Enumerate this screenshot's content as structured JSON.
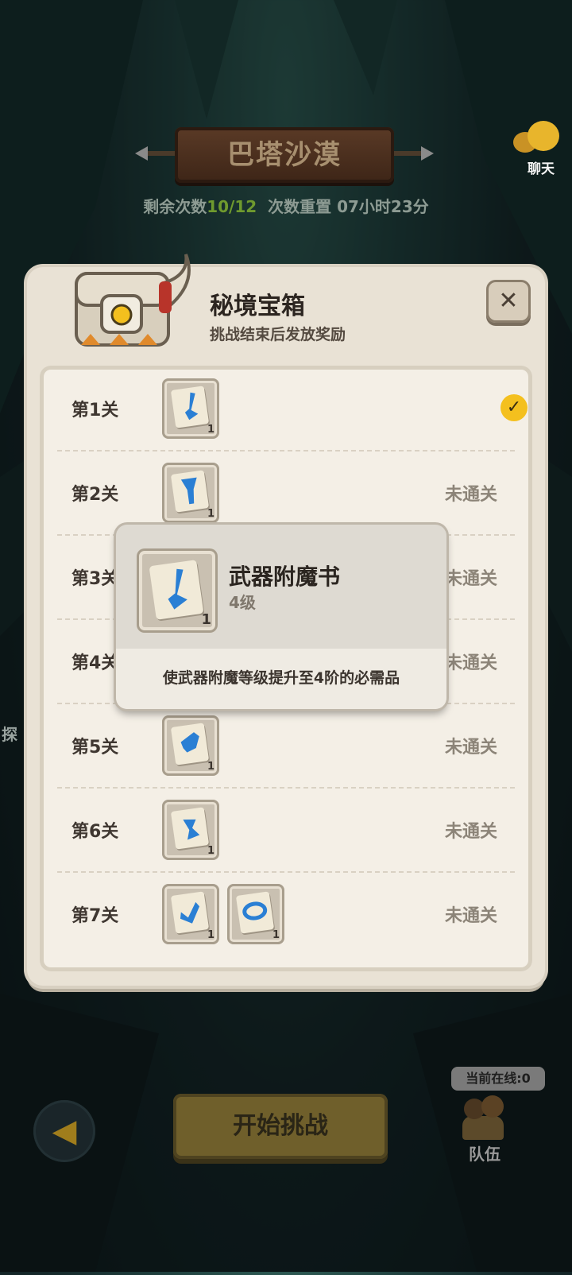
{
  "header": {
    "stage_name": "巴塔沙漠",
    "attempts_prefix": "剩余次数",
    "attempts_value": "10/12",
    "reset_text": "次数重置 07小时23分"
  },
  "chat": {
    "label": "聊天",
    "icon": "chat-bubble-icon"
  },
  "panel": {
    "title": "秘境宝箱",
    "subtitle": "挑战结束后发放奖励",
    "close_symbol": "✕"
  },
  "levels": [
    {
      "label": "第1关",
      "status": "",
      "cleared": true,
      "items": [
        {
          "icon": "enchant-scroll-icon",
          "qty": "1"
        }
      ]
    },
    {
      "label": "第2关",
      "status": "未通关",
      "cleared": false,
      "items": [
        {
          "icon": "enchant-scroll-icon",
          "qty": "1"
        }
      ]
    },
    {
      "label": "第3关",
      "status": "未通关",
      "cleared": false,
      "items": []
    },
    {
      "label": "第4关",
      "status": "未通关",
      "cleared": false,
      "items": []
    },
    {
      "label": "第5关",
      "status": "未通关",
      "cleared": false,
      "items": [
        {
          "icon": "enchant-scroll-icon",
          "qty": "1"
        }
      ]
    },
    {
      "label": "第6关",
      "status": "未通关",
      "cleared": false,
      "items": [
        {
          "icon": "enchant-scroll-icon",
          "qty": "1"
        }
      ]
    },
    {
      "label": "第7关",
      "status": "未通关",
      "cleared": false,
      "items": [
        {
          "icon": "enchant-scroll-icon",
          "qty": "1"
        },
        {
          "icon": "enchant-scroll-icon",
          "qty": "1"
        }
      ]
    }
  ],
  "tooltip": {
    "name": "武器附魔书",
    "level": "4级",
    "qty": "1",
    "description": "使武器附魔等级提升至4阶的必需品"
  },
  "footer": {
    "start_label": "开始挑战",
    "online_text": "当前在线:0",
    "team_label": "队伍",
    "left_edge_text": "探"
  },
  "colors": {
    "accent_gold": "#f4c01e",
    "cleared_count": "#6f9a2e"
  }
}
